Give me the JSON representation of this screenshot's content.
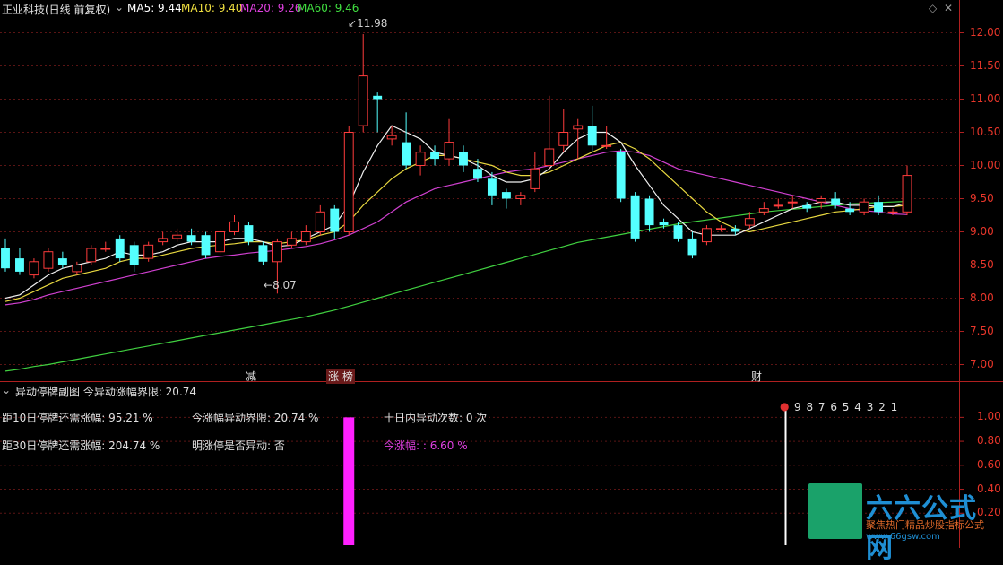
{
  "header": {
    "stock_title": "正业科技(日线 前复权)",
    "ma": [
      {
        "label": "MA5: 9.44",
        "color": "#ffffff"
      },
      {
        "label": "MA10: 9.40",
        "color": "#f0e040"
      },
      {
        "label": "MA20: 9.26",
        "color": "#e040e0"
      },
      {
        "label": "MA60: 9.46",
        "color": "#40e040"
      }
    ]
  },
  "price_axis": [
    "12.00",
    "11.50",
    "11.00",
    "10.50",
    "10.00",
    "9.50",
    "9.00",
    "8.50",
    "8.00",
    "7.50",
    "7.00"
  ],
  "annotations": {
    "high": "11.98",
    "low": "8.07"
  },
  "markers": [
    {
      "text": "减",
      "color": "#e8e8e8"
    },
    {
      "text": "涨 榜",
      "color": "#e8e8e8",
      "highlight": true
    },
    {
      "text": "财",
      "color": "#e8e8e8"
    }
  ],
  "sub_panel": {
    "title": "异动停牌副图  今异动涨幅界限: 20.74",
    "axis": [
      "1.00",
      "0.80",
      "0.60",
      "0.40",
      "0.20"
    ],
    "countdown": "9 8 7 6 5 4 3 2 1",
    "stats": {
      "d10_label": "距10日停牌还需涨幅:  95.21 %",
      "today_limit": "今涨幅异动界限:  20.74 %",
      "d10_count": "十日内异动次数:  0 次",
      "d30_label": "距30日停牌还需涨幅:  204.74 %",
      "limit_up": "明涨停是否异动:  否",
      "today_gain": "今涨幅:  :  6.60 %"
    }
  },
  "watermark": {
    "brand": "六六公式网",
    "slogan": "聚焦热门精品炒股指标公式",
    "url": "www.66gsw.com"
  },
  "chart_data": {
    "type": "candlestick",
    "candles": [
      [
        8.75,
        8.45,
        8.9,
        8.4
      ],
      [
        8.6,
        8.4,
        8.75,
        8.35
      ],
      [
        8.35,
        8.55,
        8.6,
        8.3
      ],
      [
        8.45,
        8.7,
        8.75,
        8.4
      ],
      [
        8.6,
        8.5,
        8.7,
        8.45
      ],
      [
        8.4,
        8.5,
        8.55,
        8.35
      ],
      [
        8.55,
        8.75,
        8.8,
        8.5
      ],
      [
        8.75,
        8.75,
        8.85,
        8.7
      ],
      [
        8.9,
        8.6,
        8.95,
        8.55
      ],
      [
        8.8,
        8.5,
        8.85,
        8.4
      ],
      [
        8.6,
        8.8,
        8.85,
        8.55
      ],
      [
        8.85,
        8.9,
        9.0,
        8.8
      ],
      [
        8.9,
        8.95,
        9.05,
        8.85
      ],
      [
        8.95,
        8.85,
        9.05,
        8.8
      ],
      [
        8.95,
        8.65,
        9.0,
        8.6
      ],
      [
        8.7,
        9.0,
        9.05,
        8.65
      ],
      [
        9.0,
        9.15,
        9.25,
        8.95
      ],
      [
        9.1,
        8.85,
        9.15,
        8.8
      ],
      [
        8.8,
        8.55,
        8.85,
        8.5
      ],
      [
        8.55,
        8.85,
        8.9,
        8.07
      ],
      [
        8.8,
        8.9,
        9.0,
        8.75
      ],
      [
        8.85,
        9.0,
        9.1,
        8.8
      ],
      [
        9.0,
        9.3,
        9.4,
        8.95
      ],
      [
        9.35,
        9.0,
        9.4,
        8.9
      ],
      [
        9.0,
        10.5,
        10.6,
        8.95
      ],
      [
        10.6,
        11.35,
        11.98,
        10.5
      ],
      [
        11.05,
        11.0,
        11.1,
        10.5
      ],
      [
        10.4,
        10.45,
        10.6,
        10.3
      ],
      [
        10.35,
        10.0,
        10.8,
        9.95
      ],
      [
        10.0,
        10.2,
        10.3,
        9.85
      ],
      [
        10.2,
        10.1,
        10.3,
        10.0
      ],
      [
        10.1,
        10.35,
        10.7,
        10.0
      ],
      [
        10.2,
        10.0,
        10.3,
        9.9
      ],
      [
        9.95,
        9.8,
        10.1,
        9.75
      ],
      [
        9.8,
        9.55,
        9.9,
        9.4
      ],
      [
        9.6,
        9.5,
        9.65,
        9.35
      ],
      [
        9.5,
        9.55,
        9.6,
        9.4
      ],
      [
        9.65,
        9.95,
        10.2,
        9.6
      ],
      [
        10.0,
        10.25,
        11.05,
        9.95
      ],
      [
        10.3,
        10.5,
        10.85,
        10.2
      ],
      [
        10.55,
        10.6,
        10.7,
        10.1
      ],
      [
        10.6,
        10.3,
        10.9,
        10.2
      ],
      [
        10.3,
        10.3,
        10.6,
        10.25
      ],
      [
        10.2,
        9.5,
        10.25,
        9.45
      ],
      [
        9.55,
        8.9,
        9.6,
        8.85
      ],
      [
        9.5,
        9.1,
        9.55,
        9.0
      ],
      [
        9.15,
        9.1,
        9.2,
        9.05
      ],
      [
        9.1,
        8.9,
        9.15,
        8.85
      ],
      [
        8.9,
        8.65,
        9.0,
        8.6
      ],
      [
        8.85,
        9.05,
        9.1,
        8.8
      ],
      [
        9.05,
        9.05,
        9.1,
        9.0
      ],
      [
        9.05,
        9.0,
        9.1,
        8.95
      ],
      [
        9.1,
        9.2,
        9.3,
        9.05
      ],
      [
        9.3,
        9.35,
        9.45,
        9.25
      ],
      [
        9.4,
        9.4,
        9.5,
        9.35
      ],
      [
        9.45,
        9.45,
        9.55,
        9.35
      ],
      [
        9.4,
        9.35,
        9.45,
        9.3
      ],
      [
        9.45,
        9.5,
        9.55,
        9.35
      ],
      [
        9.5,
        9.4,
        9.6,
        9.35
      ],
      [
        9.35,
        9.3,
        9.45,
        9.25
      ],
      [
        9.3,
        9.45,
        9.5,
        9.25
      ],
      [
        9.45,
        9.3,
        9.55,
        9.25
      ],
      [
        9.3,
        9.3,
        9.35,
        9.25
      ],
      [
        9.3,
        9.85,
        10.0,
        9.25
      ]
    ],
    "ma5": [
      8.0,
      8.05,
      8.2,
      8.35,
      8.45,
      8.5,
      8.55,
      8.6,
      8.7,
      8.65,
      8.65,
      8.7,
      8.8,
      8.85,
      8.85,
      8.85,
      8.9,
      8.9,
      8.85,
      8.78,
      8.8,
      8.9,
      9.0,
      9.1,
      9.4,
      9.9,
      10.3,
      10.6,
      10.5,
      10.4,
      10.2,
      10.15,
      10.1,
      10.0,
      9.85,
      9.75,
      9.75,
      9.8,
      9.95,
      10.2,
      10.4,
      10.5,
      10.5,
      10.35,
      10.0,
      9.7,
      9.4,
      9.2,
      9.0,
      8.95,
      8.95,
      8.95,
      9.05,
      9.15,
      9.25,
      9.35,
      9.4,
      9.45,
      9.45,
      9.4,
      9.4,
      9.38,
      9.38,
      9.44
    ],
    "ma10": [
      7.95,
      8.0,
      8.1,
      8.2,
      8.3,
      8.35,
      8.4,
      8.45,
      8.55,
      8.6,
      8.6,
      8.65,
      8.7,
      8.75,
      8.78,
      8.8,
      8.82,
      8.85,
      8.85,
      8.82,
      8.85,
      8.88,
      8.95,
      9.0,
      9.15,
      9.4,
      9.6,
      9.8,
      9.95,
      10.05,
      10.15,
      10.15,
      10.1,
      10.05,
      10.0,
      9.9,
      9.85,
      9.85,
      9.9,
      10.0,
      10.1,
      10.2,
      10.3,
      10.35,
      10.25,
      10.1,
      9.9,
      9.7,
      9.5,
      9.3,
      9.15,
      9.05,
      9.0,
      9.05,
      9.1,
      9.15,
      9.2,
      9.25,
      9.3,
      9.32,
      9.35,
      9.38,
      9.38,
      9.4
    ],
    "ma20": [
      7.9,
      7.93,
      7.98,
      8.05,
      8.1,
      8.15,
      8.2,
      8.25,
      8.3,
      8.35,
      8.4,
      8.45,
      8.5,
      8.55,
      8.6,
      8.63,
      8.65,
      8.68,
      8.7,
      8.72,
      8.75,
      8.78,
      8.82,
      8.88,
      8.95,
      9.05,
      9.15,
      9.3,
      9.45,
      9.55,
      9.65,
      9.7,
      9.75,
      9.8,
      9.85,
      9.9,
      9.93,
      9.95,
      10.0,
      10.05,
      10.1,
      10.15,
      10.2,
      10.22,
      10.2,
      10.15,
      10.05,
      9.95,
      9.9,
      9.85,
      9.8,
      9.75,
      9.7,
      9.65,
      9.6,
      9.55,
      9.5,
      9.45,
      9.4,
      9.35,
      9.32,
      9.3,
      9.27,
      9.26
    ],
    "ma60": [
      6.9,
      6.93,
      6.97,
      7.0,
      7.04,
      7.08,
      7.12,
      7.16,
      7.2,
      7.24,
      7.28,
      7.32,
      7.36,
      7.4,
      7.44,
      7.48,
      7.52,
      7.56,
      7.6,
      7.64,
      7.68,
      7.72,
      7.77,
      7.82,
      7.88,
      7.94,
      8.0,
      8.06,
      8.12,
      8.18,
      8.24,
      8.3,
      8.36,
      8.42,
      8.48,
      8.54,
      8.6,
      8.66,
      8.72,
      8.78,
      8.84,
      8.88,
      8.92,
      8.96,
      9.0,
      9.04,
      9.08,
      9.12,
      9.15,
      9.18,
      9.21,
      9.24,
      9.27,
      9.3,
      9.32,
      9.34,
      9.36,
      9.38,
      9.4,
      9.42,
      9.43,
      9.44,
      9.45,
      9.46
    ],
    "ylim": [
      6.75,
      12.25
    ],
    "sub_bars": [
      {
        "index": 24,
        "value": 1.0
      }
    ]
  }
}
